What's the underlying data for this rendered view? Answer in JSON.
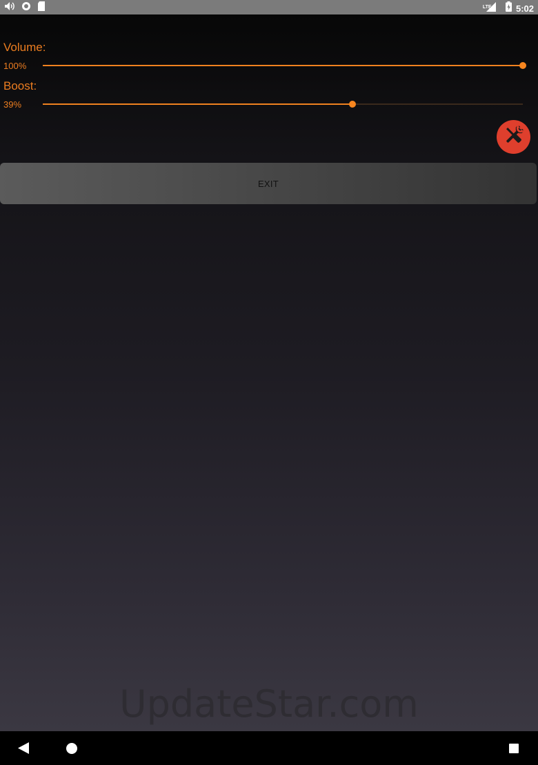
{
  "status_bar": {
    "time": "5:02",
    "network": "LTE",
    "icons": [
      "volume-icon",
      "circle-notification-icon",
      "sd-card-icon",
      "signal-icon",
      "battery-icon"
    ]
  },
  "volume": {
    "label": "Volume:",
    "percent_text": "100%",
    "value": 1.0
  },
  "boost": {
    "label": "Boost:",
    "percent_text": "39%",
    "value": 0.645
  },
  "settings_icon": "wrench-screwdriver-icon",
  "exit_button": {
    "label": "EXIT"
  },
  "watermark": "UpdateStar.com",
  "nav_bar": {
    "icons": [
      "back-icon",
      "home-icon",
      "recents-icon"
    ]
  },
  "colors": {
    "accent": "#ec7d20",
    "settings_button": "#df3f2d",
    "status_bar": "#7b7b7b"
  }
}
